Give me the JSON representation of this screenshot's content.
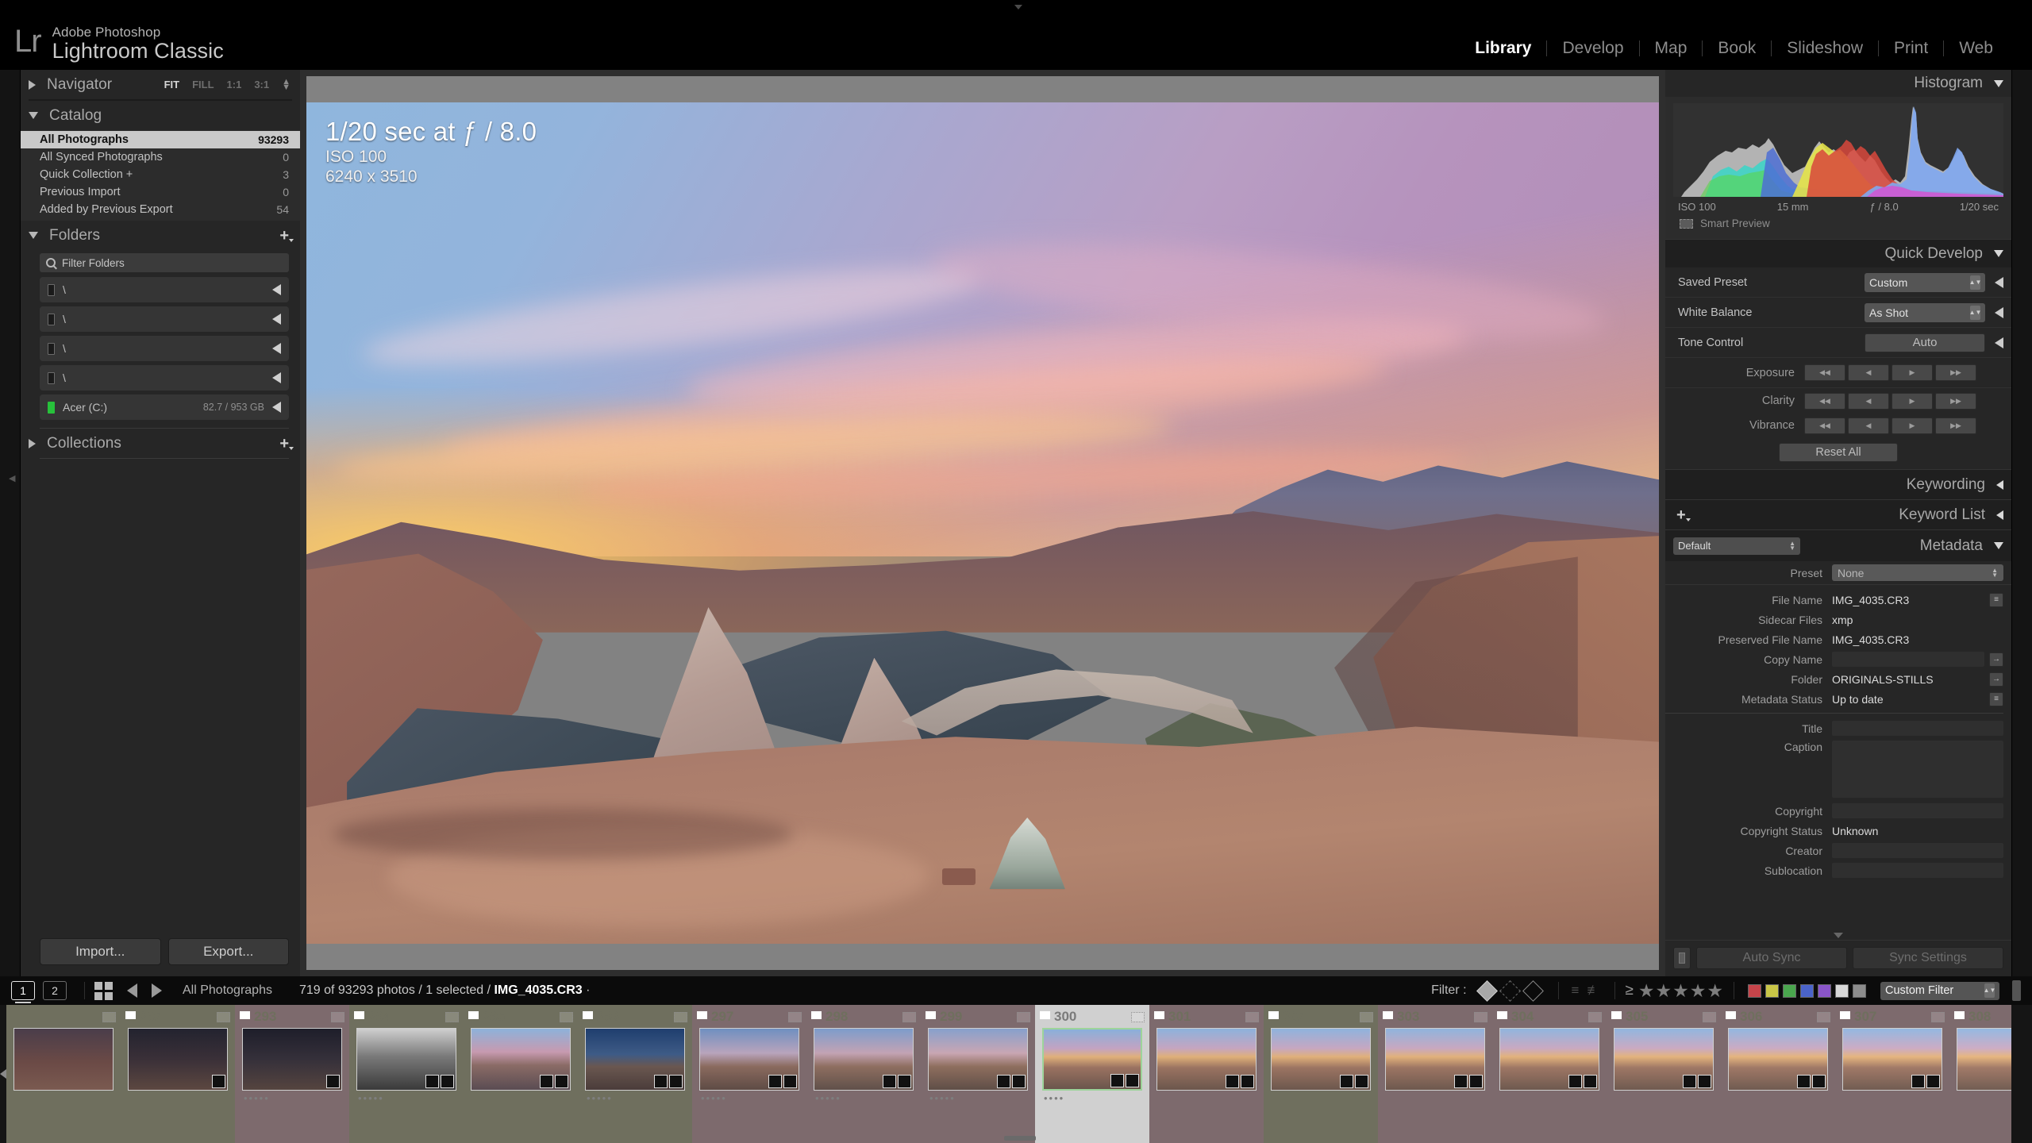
{
  "app": {
    "logo_mark": "Lr",
    "subtitle": "Adobe Photoshop",
    "title": "Lightroom Classic"
  },
  "modules": [
    {
      "label": "Library",
      "active": true
    },
    {
      "label": "Develop",
      "active": false
    },
    {
      "label": "Map",
      "active": false
    },
    {
      "label": "Book",
      "active": false
    },
    {
      "label": "Slideshow",
      "active": false
    },
    {
      "label": "Print",
      "active": false
    },
    {
      "label": "Web",
      "active": false
    }
  ],
  "left_panel": {
    "navigator": {
      "title": "Navigator",
      "zoom_levels": [
        {
          "label": "FIT",
          "active": true
        },
        {
          "label": "FILL",
          "active": false
        },
        {
          "label": "1:1",
          "active": false
        },
        {
          "label": "3:1",
          "active": false
        }
      ]
    },
    "catalog": {
      "title": "Catalog",
      "items": [
        {
          "label": "All Photographs",
          "count": "93293",
          "selected": true
        },
        {
          "label": "All Synced Photographs",
          "count": "0",
          "selected": false
        },
        {
          "label": "Quick Collection  +",
          "count": "3",
          "selected": false
        },
        {
          "label": "Previous Import",
          "count": "0",
          "selected": false
        },
        {
          "label": "Added by Previous Export",
          "count": "54",
          "selected": false
        }
      ]
    },
    "folders": {
      "title": "Folders",
      "filter_placeholder": "Filter Folders",
      "volumes": [
        {
          "name": "\\",
          "size": "",
          "green": false
        },
        {
          "name": "\\",
          "size": "",
          "green": false
        },
        {
          "name": "\\",
          "size": "",
          "green": false
        },
        {
          "name": "\\",
          "size": "",
          "green": false
        },
        {
          "name": "Acer (C:)",
          "size": "82.7 / 953 GB",
          "green": true
        }
      ]
    },
    "collections": {
      "title": "Collections"
    },
    "import_label": "Import...",
    "export_label": "Export..."
  },
  "photo": {
    "exposure_line": "1/20 sec at ƒ / 8.0",
    "iso_line": "ISO 100",
    "dimensions_line": "6240 x 3510"
  },
  "right_panel": {
    "histogram": {
      "title": "Histogram",
      "iso": "ISO 100",
      "focal": "15 mm",
      "aperture": "ƒ / 8.0",
      "shutter": "1/20 sec",
      "smart_preview": "Smart Preview"
    },
    "quick_develop": {
      "title": "Quick Develop",
      "saved_preset_label": "Saved Preset",
      "saved_preset_value": "Custom",
      "white_balance_label": "White Balance",
      "white_balance_value": "As Shot",
      "tone_control_label": "Tone Control",
      "auto_label": "Auto",
      "exposure_label": "Exposure",
      "clarity_label": "Clarity",
      "vibrance_label": "Vibrance",
      "reset_label": "Reset All"
    },
    "keywording_title": "Keywording",
    "keyword_list_title": "Keyword List",
    "metadata": {
      "title": "Metadata",
      "view_preset": "Default",
      "preset_label": "Preset",
      "preset_value": "None",
      "fields": [
        {
          "label": "File Name",
          "value": "IMG_4035.CR3",
          "type": "text",
          "button": "list"
        },
        {
          "label": "Sidecar Files",
          "value": "xmp",
          "type": "text",
          "button": ""
        },
        {
          "label": "Preserved File Name",
          "value": "IMG_4035.CR3",
          "type": "text",
          "button": ""
        },
        {
          "label": "Copy Name",
          "value": "",
          "type": "field",
          "button": "arrow"
        },
        {
          "label": "Folder",
          "value": "ORIGINALS-STILLS",
          "type": "text",
          "button": "arrow"
        },
        {
          "label": "Metadata Status",
          "value": "Up to date",
          "type": "text",
          "button": "list"
        },
        {
          "label": "Title",
          "value": "",
          "type": "field",
          "button": ""
        },
        {
          "label": "Caption",
          "value": "",
          "type": "field-tall",
          "button": ""
        },
        {
          "label": "Copyright",
          "value": "",
          "type": "field",
          "button": ""
        },
        {
          "label": "Copyright Status",
          "value": "Unknown",
          "type": "stepper",
          "button": ""
        },
        {
          "label": "Creator",
          "value": "",
          "type": "field",
          "button": ""
        },
        {
          "label": "Sublocation",
          "value": "",
          "type": "field",
          "button": ""
        }
      ]
    },
    "auto_sync_label": "Auto Sync",
    "sync_settings_label": "Sync Settings"
  },
  "toolbar": {
    "page1": "1",
    "page2": "2",
    "source": "All Photographs",
    "status": "719 of 93293 photos / 1 selected / ",
    "status_file": "IMG_4035.CR3",
    "status_suffix": " ·",
    "filter_label": "Filter :",
    "custom_filter": "Custom Filter",
    "color_swatches": [
      "#c6444a",
      "#c9c647",
      "#4aa64e",
      "#4a63c9",
      "#8a55c9",
      "#d8d8d8",
      "#8c8c8c"
    ]
  },
  "filmstrip": {
    "cells": [
      {
        "num": "",
        "selected": false,
        "dots": "",
        "band": "#6f6f5e",
        "partial": true
      },
      {
        "num": "292",
        "selected": false,
        "dots": "",
        "band": "#6f6f5e"
      },
      {
        "num": "293",
        "selected": false,
        "dots": "•••••",
        "band": "#7d6a6d"
      },
      {
        "num": "294",
        "selected": false,
        "dots": "•••••",
        "band": "#6f6f5e"
      },
      {
        "num": "295",
        "selected": false,
        "dots": "",
        "band": "#6f6f5e"
      },
      {
        "num": "296",
        "selected": false,
        "dots": "•••••",
        "band": "#6f6f5e"
      },
      {
        "num": "297",
        "selected": false,
        "dots": "•••••",
        "band": "#7d6a6d"
      },
      {
        "num": "298",
        "selected": false,
        "dots": "•••••",
        "band": "#7d6a6d"
      },
      {
        "num": "299",
        "selected": false,
        "dots": "•••••",
        "band": "#7d6a6d"
      },
      {
        "num": "300",
        "selected": true,
        "dots": "••••",
        "band": "#d0d0d0"
      },
      {
        "num": "301",
        "selected": false,
        "dots": "",
        "band": "#7d6a6d"
      },
      {
        "num": "302",
        "selected": false,
        "dots": "",
        "band": "#6f6f5e"
      },
      {
        "num": "303",
        "selected": false,
        "dots": "",
        "band": "#7d6a6d"
      },
      {
        "num": "304",
        "selected": false,
        "dots": "",
        "band": "#7d6a6d"
      },
      {
        "num": "305",
        "selected": false,
        "dots": "",
        "band": "#7d6a6d"
      },
      {
        "num": "306",
        "selected": false,
        "dots": "",
        "band": "#7d6a6d"
      },
      {
        "num": "307",
        "selected": false,
        "dots": "",
        "band": "#7d6a6d"
      },
      {
        "num": "308",
        "selected": false,
        "dots": "",
        "band": "#7d6a6d"
      },
      {
        "num": "3",
        "selected": false,
        "dots": "••••",
        "band": "#7d6a6d",
        "partial": true
      }
    ]
  }
}
